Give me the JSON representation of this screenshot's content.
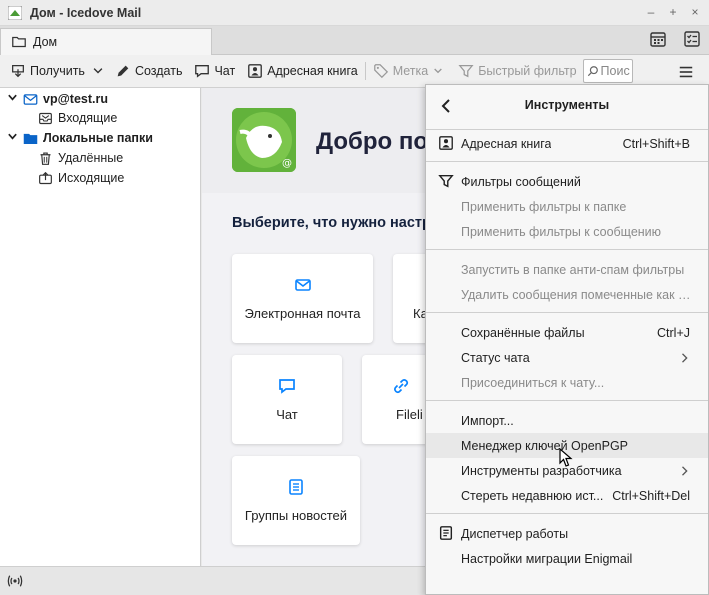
{
  "window": {
    "title": "Дом - Icedove Mail",
    "controls": [
      "–",
      "+",
      "×"
    ]
  },
  "tabs": [
    {
      "label": "Дом",
      "icon": "folder-icon",
      "active": true
    }
  ],
  "toolbar": {
    "get_mail": "Получить",
    "compose": "Создать",
    "chat": "Чат",
    "address_book": "Адресная книга",
    "tag": "Метка",
    "quick_filter": "Быстрый фильтр",
    "search_placeholder": "Поис"
  },
  "folders": {
    "account": "vp@test.ru",
    "inbox": "Входящие",
    "local_folders": "Локальные папки",
    "trash": "Удалённые",
    "outbox": "Исходящие"
  },
  "content": {
    "welcome": "Добро пож",
    "subhead": "Выберите, что нужно настро",
    "cards": [
      {
        "label": "Электронная почта",
        "icon": "mail-icon"
      },
      {
        "label": "Ка",
        "icon": "calendar-icon"
      },
      {
        "label": "Чат",
        "icon": "chat-icon"
      },
      {
        "label": "Fileli",
        "icon": "link-icon"
      },
      {
        "label": "Группы новостей",
        "icon": "newsgroup-icon"
      }
    ]
  },
  "menu": {
    "title": "Инструменты",
    "items": [
      {
        "label": "Адресная книга",
        "shortcut": "Ctrl+Shift+B",
        "icon": "address-book-icon",
        "disabled": false
      },
      {
        "label": "Фильтры сообщений",
        "shortcut": "",
        "icon": "filter-icon",
        "disabled": false
      },
      {
        "label": "Применить фильтры к папке",
        "shortcut": "",
        "disabled": true
      },
      {
        "label": "Применить фильтры к сообщению",
        "shortcut": "",
        "disabled": true
      },
      {
        "label": "Запустить в папке анти-спам фильтры",
        "shortcut": "",
        "disabled": true
      },
      {
        "label": "Удалить сообщения помеченные как с...",
        "shortcut": "",
        "disabled": true
      },
      {
        "label": "Сохранённые файлы",
        "shortcut": "Ctrl+J",
        "disabled": false
      },
      {
        "label": "Статус чата",
        "shortcut": "",
        "submenu": true,
        "disabled": false
      },
      {
        "label": "Присоединиться к чату...",
        "shortcut": "",
        "disabled": true
      },
      {
        "label": "Импорт...",
        "shortcut": "",
        "disabled": false
      },
      {
        "label": "Менеджер ключей OpenPGP",
        "shortcut": "",
        "disabled": false,
        "hover": true
      },
      {
        "label": "Инструменты разработчика",
        "shortcut": "",
        "submenu": true,
        "disabled": false
      },
      {
        "label": "Стереть недавнюю ист...",
        "shortcut": "Ctrl+Shift+Del",
        "disabled": false
      },
      {
        "label": "Диспетчер работы",
        "shortcut": "",
        "icon": "activity-icon",
        "disabled": false
      },
      {
        "label": "Настройки миграции Enigmail",
        "shortcut": "",
        "disabled": false
      }
    ]
  },
  "colors": {
    "accent": "#0a84ff",
    "heading": "#20233b",
    "disabled_text": "#8a8a8a"
  }
}
